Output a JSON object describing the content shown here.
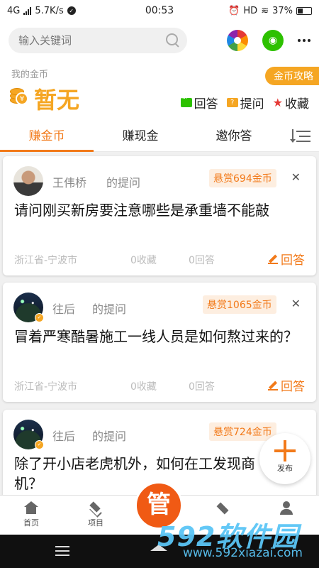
{
  "status_bar": {
    "network": "4G",
    "speed": "5.7K/s",
    "time": "00:53",
    "hd": "HD",
    "battery": "37%"
  },
  "search": {
    "placeholder": "输入关键词"
  },
  "gold": {
    "label": "我的金币",
    "amount": "暂无",
    "strategy": "金币攻略",
    "actions": {
      "answer": "回答",
      "ask": "提问",
      "favorite": "收藏"
    }
  },
  "tabs": [
    "赚金币",
    "赚现金",
    "邀你答"
  ],
  "questions": [
    {
      "user": "王伟桥",
      "asked": "的提问",
      "bounty": "悬赏694金币",
      "title": "请问刚买新房要注意哪些是承重墙不能敲",
      "location": "浙江省-宁波市",
      "favorites": "0收藏",
      "answers": "0回答",
      "answer_btn": "回答"
    },
    {
      "user": "往后",
      "asked": "的提问",
      "bounty": "悬赏1065金币",
      "title": "冒着严寒酷暑施工一线人员是如何熬过来的？",
      "location": "浙江省-宁波市",
      "favorites": "0收藏",
      "answers": "0回答",
      "answer_btn": "回答"
    },
    {
      "user": "往后",
      "asked": "的提问",
      "bounty": "悬赏724金币",
      "title": "除了开小店老虎机外，如何在工发现商机？"
    }
  ],
  "fab": {
    "label": "发布"
  },
  "bottom_nav": {
    "home": "首页",
    "project": "项目",
    "center": "管"
  },
  "watermark": {
    "big": "592软件园",
    "small": "www.592xiazai.com"
  },
  "colors": {
    "accent": "#f27a1a",
    "gold": "#f5a623",
    "wechat": "#2dc100"
  }
}
